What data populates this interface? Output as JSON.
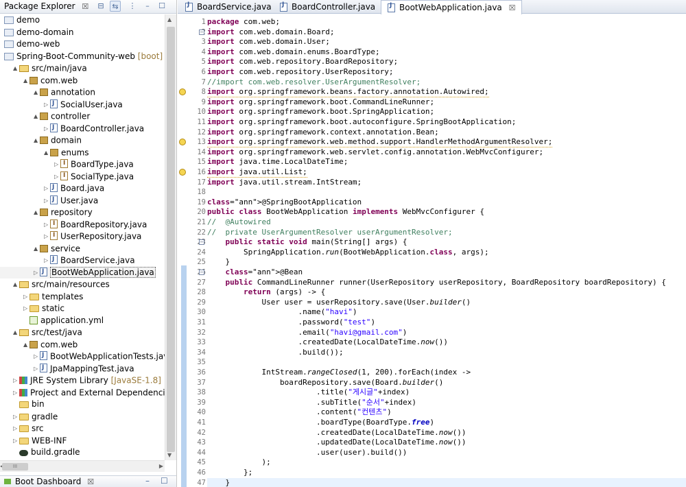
{
  "package_explorer": {
    "title": "Package Explorer",
    "tab_close": "☒",
    "tree": [
      {
        "label": "demo",
        "icon": "project-icon",
        "level": 0,
        "twisty": ""
      },
      {
        "label": "demo-domain",
        "icon": "project-icon",
        "level": 0,
        "twisty": ""
      },
      {
        "label": "demo-web",
        "icon": "project-icon",
        "level": 0,
        "twisty": ""
      },
      {
        "label": "Spring-Boot-Community-web",
        "deco": " [boot] [de",
        "icon": "boot-project-icon",
        "level": 0,
        "twisty": ""
      },
      {
        "label": "src/main/java",
        "icon": "source-folder-icon",
        "level": 1,
        "twisty": "▲"
      },
      {
        "label": "com.web",
        "icon": "package-icon",
        "level": 2,
        "twisty": "▲"
      },
      {
        "label": "annotation",
        "icon": "package-icon",
        "level": 3,
        "twisty": "▲"
      },
      {
        "label": "SocialUser.java",
        "icon": "annotation-file-icon",
        "level": 4,
        "twisty": "▷"
      },
      {
        "label": "controller",
        "icon": "package-icon",
        "level": 3,
        "twisty": "▲"
      },
      {
        "label": "BoardController.java",
        "icon": "java-file-icon",
        "level": 4,
        "twisty": "▷"
      },
      {
        "label": "domain",
        "icon": "package-icon",
        "level": 3,
        "twisty": "▲"
      },
      {
        "label": "enums",
        "icon": "package-icon",
        "level": 4,
        "twisty": "▲"
      },
      {
        "label": "BoardType.java",
        "icon": "enum-file-icon",
        "level": 5,
        "twisty": "▷"
      },
      {
        "label": "SocialType.java",
        "icon": "enum-file-icon",
        "level": 5,
        "twisty": "▷"
      },
      {
        "label": "Board.java",
        "icon": "java-file-icon",
        "level": 4,
        "twisty": "▷"
      },
      {
        "label": "User.java",
        "icon": "java-file-icon",
        "level": 4,
        "twisty": "▷"
      },
      {
        "label": "repository",
        "icon": "package-icon",
        "level": 3,
        "twisty": "▲"
      },
      {
        "label": "BoardRepository.java",
        "icon": "interface-file-icon",
        "level": 4,
        "twisty": "▷"
      },
      {
        "label": "UserRepository.java",
        "icon": "interface-file-icon",
        "level": 4,
        "twisty": "▷"
      },
      {
        "label": "service",
        "icon": "package-icon",
        "level": 3,
        "twisty": "▲"
      },
      {
        "label": "BoardService.java",
        "icon": "java-file-icon",
        "level": 4,
        "twisty": "▷"
      },
      {
        "label": "BootWebApplication.java",
        "icon": "java-file-icon",
        "level": 3,
        "twisty": "▷",
        "selected": true
      },
      {
        "label": "src/main/resources",
        "icon": "source-folder-icon",
        "level": 1,
        "twisty": "▲"
      },
      {
        "label": "templates",
        "icon": "folder-icon",
        "level": 2,
        "twisty": "▷"
      },
      {
        "label": "static",
        "icon": "folder-icon",
        "level": 2,
        "twisty": "▷"
      },
      {
        "label": "application.yml",
        "icon": "yml-file-icon",
        "level": 2,
        "twisty": ""
      },
      {
        "label": "src/test/java",
        "icon": "source-folder-icon",
        "level": 1,
        "twisty": "▲"
      },
      {
        "label": "com.web",
        "icon": "package-icon",
        "level": 2,
        "twisty": "▲"
      },
      {
        "label": "BootWebApplicationTests.java",
        "icon": "java-file-icon",
        "level": 3,
        "twisty": "▷"
      },
      {
        "label": "JpaMappingTest.java",
        "icon": "java-file-icon",
        "level": 3,
        "twisty": "▷"
      },
      {
        "label": "JRE System Library",
        "deco": " [JavaSE-1.8]",
        "icon": "library-icon",
        "level": 1,
        "twisty": "▷"
      },
      {
        "label": "Project and External Dependencies",
        "icon": "library-icon",
        "level": 1,
        "twisty": "▷"
      },
      {
        "label": "bin",
        "icon": "folder-icon",
        "level": 1,
        "twisty": ""
      },
      {
        "label": "gradle",
        "icon": "folder-icon",
        "level": 1,
        "twisty": "▷"
      },
      {
        "label": "src",
        "icon": "folder-icon",
        "level": 1,
        "twisty": "▷"
      },
      {
        "label": "WEB-INF",
        "icon": "folder-icon",
        "level": 1,
        "twisty": "▷"
      },
      {
        "label": "build.gradle",
        "icon": "gradle-file-icon",
        "level": 1,
        "twisty": ""
      }
    ],
    "hscroll_label": "III"
  },
  "boot_dashboard": {
    "title": "Boot Dashboard",
    "close": "☒"
  },
  "editor_tabs": [
    {
      "label": "BoardService.java",
      "active": false
    },
    {
      "label": "BoardController.java",
      "active": false
    },
    {
      "label": "BootWebApplication.java",
      "active": true,
      "close": "☒"
    }
  ],
  "editor": {
    "lines": [
      "package com.web;",
      "import com.web.domain.Board;",
      "import com.web.domain.User;",
      "import com.web.domain.enums.BoardType;",
      "import com.web.repository.BoardRepository;",
      "import com.web.repository.UserRepository;",
      "//import com.web.resolver.UserArgumentResolver;",
      "import org.springframework.beans.factory.annotation.Autowired;",
      "import org.springframework.boot.CommandLineRunner;",
      "import org.springframework.boot.SpringApplication;",
      "import org.springframework.boot.autoconfigure.SpringBootApplication;",
      "import org.springframework.context.annotation.Bean;",
      "import org.springframework.web.method.support.HandlerMethodArgumentResolver;",
      "import org.springframework.web.servlet.config.annotation.WebMvcConfigurer;",
      "import java.time.LocalDateTime;",
      "import java.util.List;",
      "import java.util.stream.IntStream;",
      "",
      "@SpringBootApplication",
      "public class BootWebApplication implements WebMvcConfigurer {",
      "//  @Autowired",
      "//  private UserArgumentResolver userArgumentResolver;",
      "    public static void main(String[] args) {",
      "        SpringApplication.run(BootWebApplication.class, args);",
      "    }",
      "    @Bean",
      "    public CommandLineRunner runner(UserRepository userRepository, BoardRepository boardRepository) {",
      "        return (args) -> {",
      "            User user = userRepository.save(User.builder()",
      "                    .name(\"havi\")",
      "                    .password(\"test\")",
      "                    .email(\"havi@gmail.com\")",
      "                    .createdDate(LocalDateTime.now())",
      "                    .build());",
      "",
      "            IntStream.rangeClosed(1, 200).forEach(index ->",
      "                boardRepository.save(Board.builder()",
      "                        .title(\"게시글\"+index)",
      "                        .subTitle(\"순서\"+index)",
      "                        .content(\"컨텐츠\")",
      "                        .boardType(BoardType.free)",
      "                        .createdDate(LocalDateTime.now())",
      "                        .updatedDate(LocalDateTime.now())",
      "                        .user(user).build())",
      "            );",
      "        };",
      "    }"
    ],
    "warning_lines": [
      8,
      13,
      16
    ],
    "folded_markers": [
      2,
      23,
      26
    ]
  }
}
